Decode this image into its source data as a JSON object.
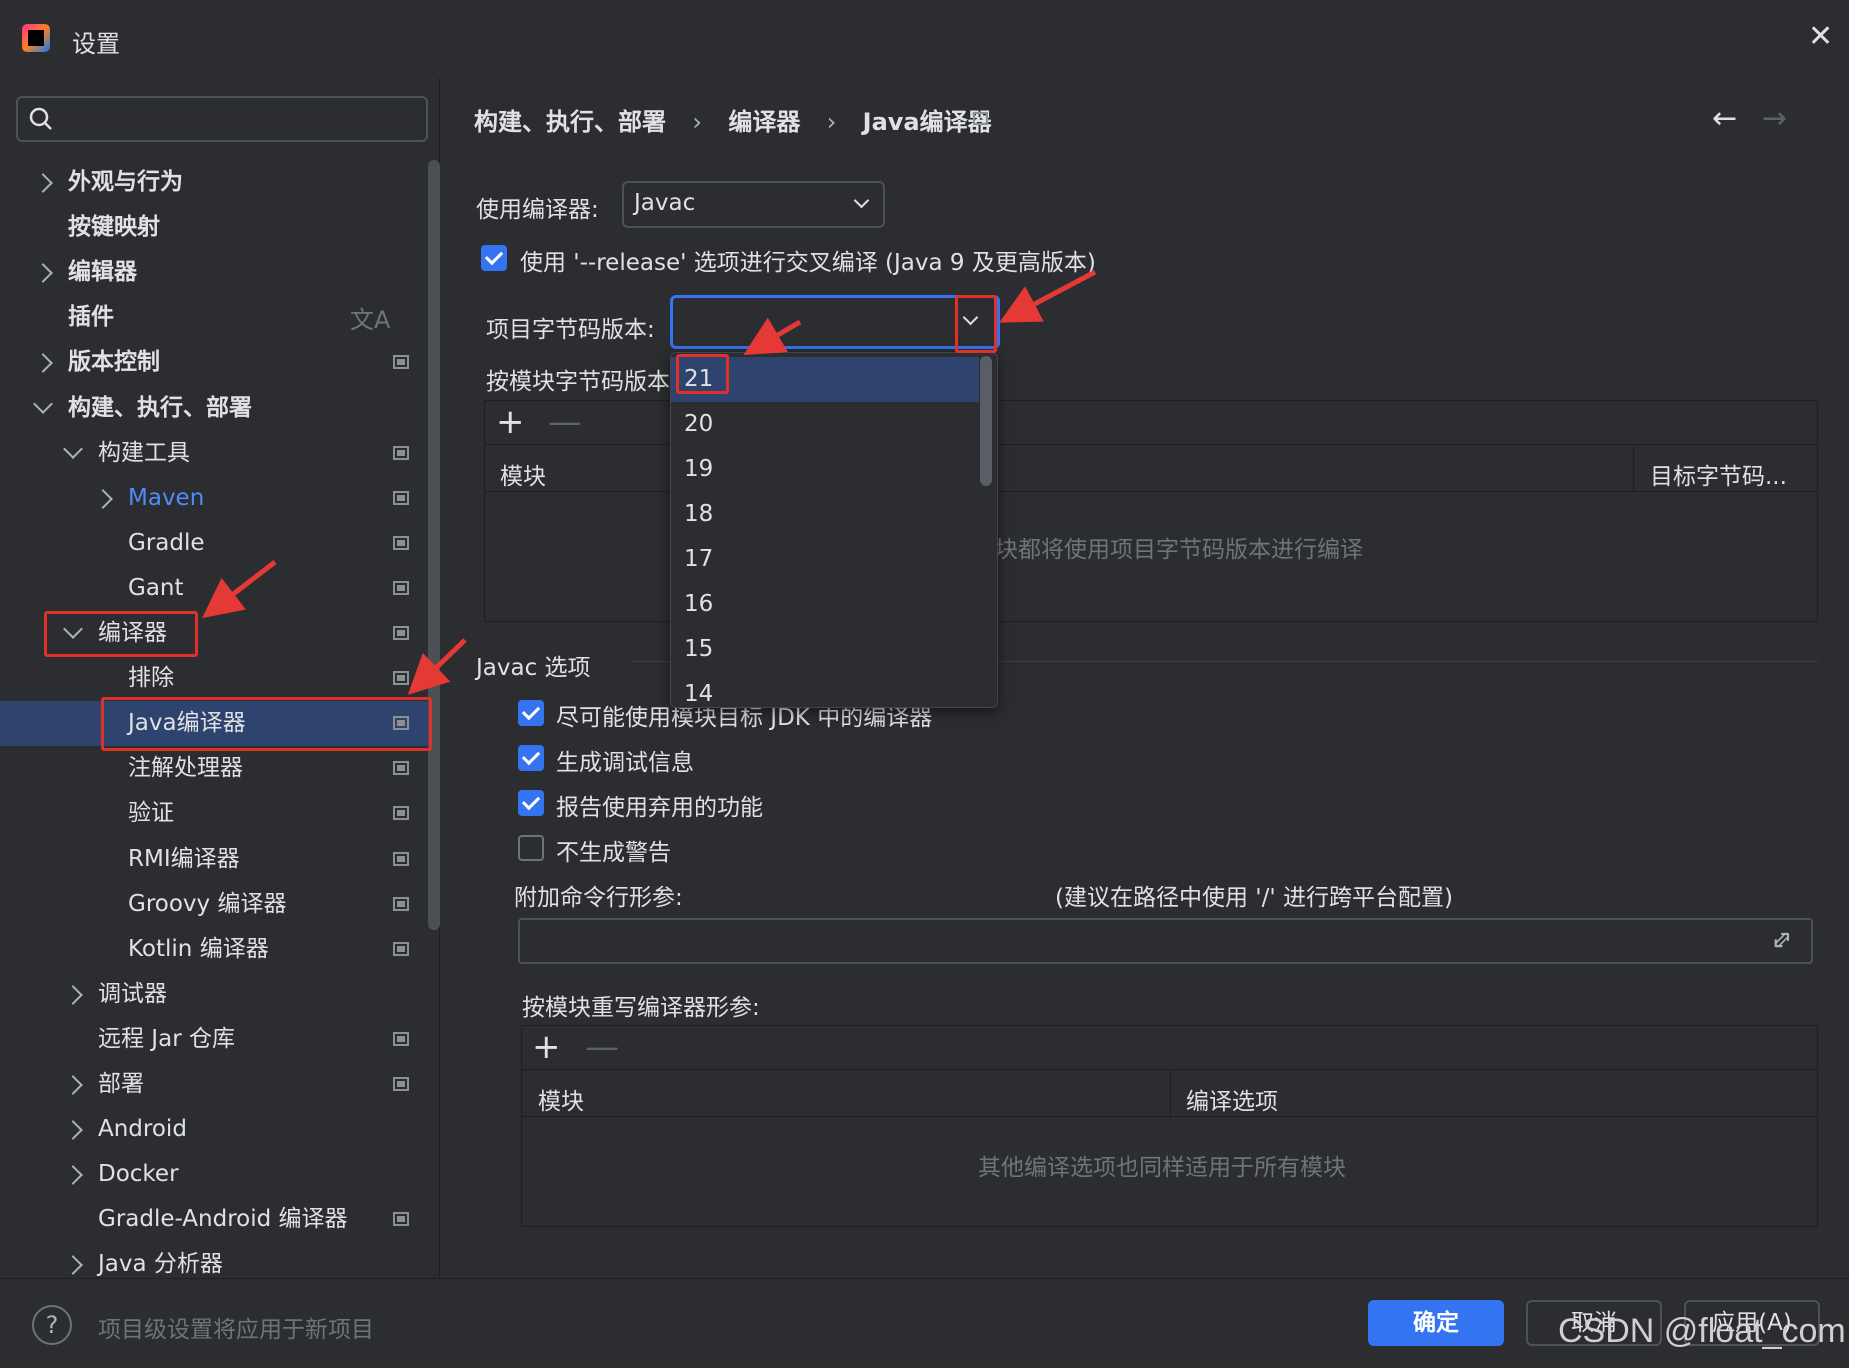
{
  "window": {
    "title": "设置"
  },
  "search": {
    "placeholder": ""
  },
  "sidebar": {
    "items": [
      {
        "label": "外观与行为",
        "expander": "right",
        "indent": 0,
        "bold": true,
        "project_icon": false
      },
      {
        "label": "按键映射",
        "expander": "none",
        "indent": 0,
        "bold": true,
        "project_icon": false
      },
      {
        "label": "编辑器",
        "expander": "right",
        "indent": 0,
        "bold": true,
        "project_icon": false
      },
      {
        "label": "插件",
        "expander": "none",
        "indent": 0,
        "bold": true,
        "project_icon": false,
        "translate_icon": true
      },
      {
        "label": "版本控制",
        "expander": "right",
        "indent": 0,
        "bold": true,
        "project_icon": true
      },
      {
        "label": "构建、执行、部署",
        "expander": "down",
        "indent": 0,
        "bold": true,
        "project_icon": false
      },
      {
        "label": "构建工具",
        "expander": "down",
        "indent": 1,
        "bold": false,
        "project_icon": true
      },
      {
        "label": "Maven",
        "expander": "right",
        "indent": 2,
        "bold": false,
        "project_icon": true,
        "highlight": true
      },
      {
        "label": "Gradle",
        "expander": "none",
        "indent": 2,
        "bold": false,
        "project_icon": true
      },
      {
        "label": "Gant",
        "expander": "none",
        "indent": 2,
        "bold": false,
        "project_icon": true
      },
      {
        "label": "编译器",
        "expander": "down",
        "indent": 1,
        "bold": false,
        "project_icon": true
      },
      {
        "label": "排除",
        "expander": "none",
        "indent": 2,
        "bold": false,
        "project_icon": true
      },
      {
        "label": "Java编译器",
        "expander": "none",
        "indent": 2,
        "bold": false,
        "project_icon": true,
        "selected": true
      },
      {
        "label": "注解处理器",
        "expander": "none",
        "indent": 2,
        "bold": false,
        "project_icon": true
      },
      {
        "label": "验证",
        "expander": "none",
        "indent": 2,
        "bold": false,
        "project_icon": true
      },
      {
        "label": "RMI编译器",
        "expander": "none",
        "indent": 2,
        "bold": false,
        "project_icon": true
      },
      {
        "label": "Groovy 编译器",
        "expander": "none",
        "indent": 2,
        "bold": false,
        "project_icon": true
      },
      {
        "label": "Kotlin 编译器",
        "expander": "none",
        "indent": 2,
        "bold": false,
        "project_icon": true
      },
      {
        "label": "调试器",
        "expander": "right",
        "indent": 1,
        "bold": false,
        "project_icon": false
      },
      {
        "label": "远程 Jar 仓库",
        "expander": "none",
        "indent": 1,
        "bold": false,
        "project_icon": true
      },
      {
        "label": "部署",
        "expander": "right",
        "indent": 1,
        "bold": false,
        "project_icon": true
      },
      {
        "label": "Android",
        "expander": "right",
        "indent": 1,
        "bold": false,
        "project_icon": false
      },
      {
        "label": "Docker",
        "expander": "right",
        "indent": 1,
        "bold": false,
        "project_icon": false
      },
      {
        "label": "Gradle-Android 编译器",
        "expander": "none",
        "indent": 1,
        "bold": false,
        "project_icon": true
      },
      {
        "label": "Java 分析器",
        "expander": "right",
        "indent": 1,
        "bold": false,
        "project_icon": false
      }
    ]
  },
  "breadcrumb": [
    "构建、执行、部署",
    "编译器",
    "Java编译器"
  ],
  "breadcrumb_sep": "›",
  "nav": {
    "back": "←",
    "forward": "→"
  },
  "compiler": {
    "label": "使用编译器:",
    "value": "Javac"
  },
  "release_option": {
    "label": "使用 '--release' 选项进行交叉编译 (Java 9 及更高版本)",
    "checked": true
  },
  "bytecode": {
    "label": "项目字节码版本:",
    "value": ""
  },
  "per_module": {
    "label": "按模块字节码版本",
    "add": "+",
    "remove": "—",
    "col_module": "模块",
    "col_target": "目标字节码...",
    "empty_text": "块都将使用项目字节码版本进行编译"
  },
  "dropdown": {
    "options": [
      "21",
      "20",
      "19",
      "18",
      "17",
      "16",
      "15",
      "14"
    ],
    "selected_index": 0
  },
  "javac": {
    "title": "Javac 选项",
    "options": [
      {
        "label": "尽可能使用模块目标 JDK 中的编译器",
        "checked": true
      },
      {
        "label": "生成调试信息",
        "checked": true
      },
      {
        "label": "报告使用弃用的功能",
        "checked": true
      },
      {
        "label": "不生成警告",
        "checked": false
      }
    ],
    "extra_args_label": "附加命令行形参:",
    "extra_args_hint": "(建议在路径中使用 '/' 进行跨平台配置)",
    "extra_args_value": ""
  },
  "override": {
    "label": "按模块重写编译器形参:",
    "add": "+",
    "remove": "—",
    "col_module": "模块",
    "col_options": "编译选项",
    "empty_text": "其他编译选项也同样适用于所有模块"
  },
  "footer": {
    "help": "?",
    "note": "项目级设置将应用于新项目",
    "ok": "确定",
    "cancel": "取消",
    "apply": "应用(A)"
  },
  "watermark": "CSDN @float_com",
  "colors": {
    "accent": "#3574f0",
    "selection": "#2e436e",
    "annotation": "#e0302a",
    "background": "#2b2d30"
  },
  "icons": {
    "close": "close-icon",
    "search": "search-icon",
    "expand": "expand-icon",
    "project": "project-level-icon"
  }
}
